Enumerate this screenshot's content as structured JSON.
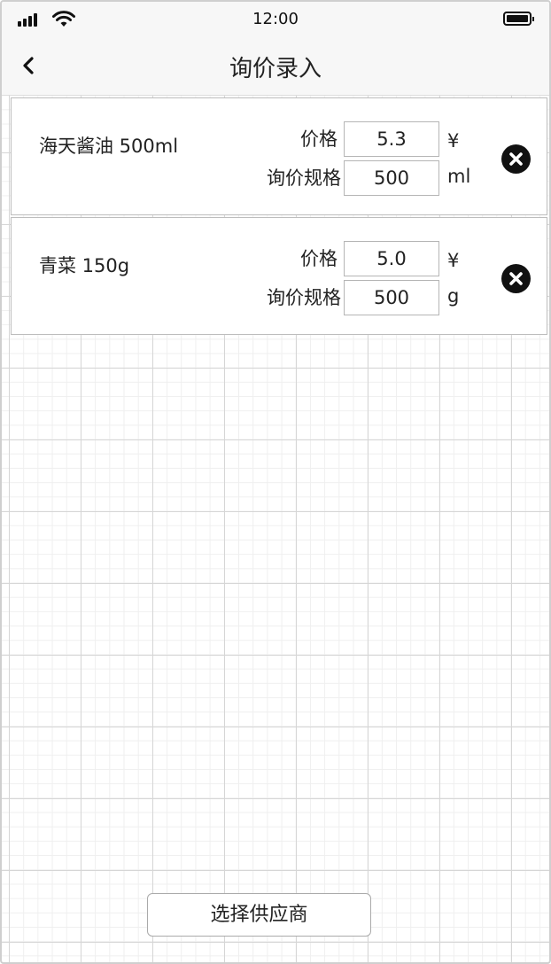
{
  "status_bar": {
    "time": "12:00",
    "signal_icon": "signal-icon",
    "wifi_icon": "wifi-icon",
    "battery_icon": "battery-icon"
  },
  "nav": {
    "title": "询价录入",
    "back_icon": "chevron-left-icon"
  },
  "items": [
    {
      "name": "海天酱油 500ml",
      "price_label": "价格",
      "price_value": "5.3",
      "price_unit": "¥",
      "spec_label": "询价规格",
      "spec_value": "500",
      "spec_unit": "ml",
      "remove_icon": "close-circle-icon"
    },
    {
      "name": "青菜 150g",
      "price_label": "价格",
      "price_value": "5.0",
      "price_unit": "¥",
      "spec_label": "询价规格",
      "spec_value": "500",
      "spec_unit": "g",
      "remove_icon": "close-circle-icon"
    }
  ],
  "footer": {
    "select_supplier_label": "选择供应商"
  },
  "colors": {
    "bar_background": "#f7f7f7",
    "text": "#222222",
    "grid_major": "#d6d6d6",
    "grid_minor": "#efefef"
  }
}
